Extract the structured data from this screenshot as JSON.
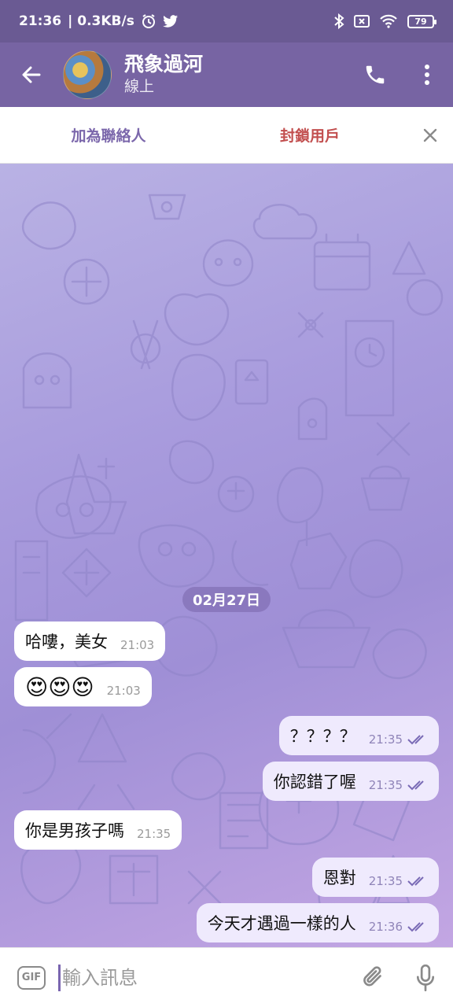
{
  "status_bar": {
    "time": "21:36",
    "speed": "| 0.3KB/s",
    "battery": "79",
    "icons": [
      "alarm-icon",
      "twitter-icon",
      "bluetooth-icon",
      "sim-off-icon",
      "wifi-icon",
      "battery-icon"
    ]
  },
  "header": {
    "name": "飛象過河",
    "status": "線上",
    "icons": [
      "back-arrow-icon",
      "phone-icon",
      "more-vert-icon"
    ]
  },
  "action_strip": {
    "add_contact": "加為聯絡人",
    "block_user": "封鎖用戶"
  },
  "chat": {
    "date_chip": "02月27日",
    "messages": [
      {
        "dir": "in",
        "text": "哈嘍，美女",
        "time": "21:03"
      },
      {
        "dir": "in",
        "text": "😍😍😍",
        "time": "21:03"
      },
      {
        "dir": "out",
        "text": "？？？？",
        "time": "21:35",
        "read": true
      },
      {
        "dir": "out",
        "text": "你認錯了喔",
        "time": "21:35",
        "read": true
      },
      {
        "dir": "in",
        "text": "你是男孩子嗎",
        "time": "21:35"
      },
      {
        "dir": "out",
        "text": "恩對",
        "time": "21:35",
        "read": true
      },
      {
        "dir": "out",
        "text": "今天才遇過一樣的人",
        "time": "21:36",
        "read": true
      }
    ]
  },
  "input_bar": {
    "gif_label": "GIF",
    "placeholder": "輸入訊息"
  },
  "colors": {
    "header": "#7764a3",
    "status_bar": "#6a5a93",
    "accent": "#7b67ab",
    "danger": "#c24f4f",
    "incoming_bubble": "#ffffff",
    "outgoing_bubble": "#efeafd"
  }
}
